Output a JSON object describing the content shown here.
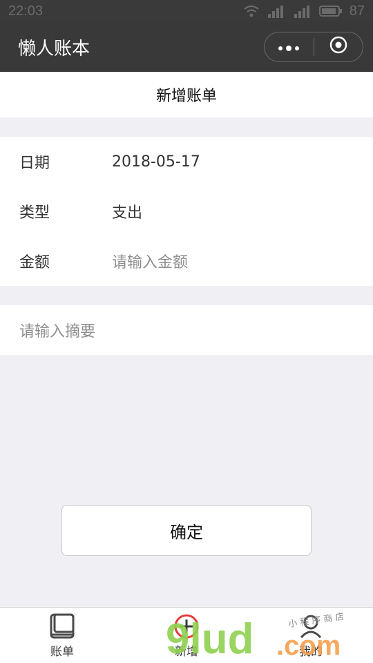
{
  "status_bar": {
    "time": "22:03",
    "battery": "87",
    "icons": [
      "wifi-icon",
      "signal-icon",
      "signal-icon",
      "battery-icon"
    ]
  },
  "nav": {
    "app_title": "懒人账本",
    "capsule": {
      "icons": [
        "more-dots-icon",
        "target-circle-icon"
      ]
    }
  },
  "page": {
    "title": "新增账单"
  },
  "form": {
    "rows": [
      {
        "label": "日期",
        "value": "2018-05-17"
      },
      {
        "label": "类型",
        "value": "支出"
      },
      {
        "label": "金额",
        "placeholder": "请输入金额"
      }
    ],
    "summary_placeholder": "请输入摘要"
  },
  "actions": {
    "confirm_label": "确定"
  },
  "tabbar": {
    "items": [
      {
        "label": "账单",
        "icon": "book-icon"
      },
      {
        "label": "新增",
        "icon": "plus-circle-icon"
      },
      {
        "label": "我的",
        "icon": "user-icon"
      }
    ]
  },
  "watermark": {
    "text": "9lud.com",
    "subtext": "小 程 序 商 店"
  },
  "colors": {
    "status_bg": "#3a3a3a",
    "nav_bg": "#393939",
    "page_bg": "#efeff4",
    "watermark_green": "#8fd14f",
    "watermark_orange": "#f6a04d",
    "watermark_red": "#e63b3b"
  }
}
